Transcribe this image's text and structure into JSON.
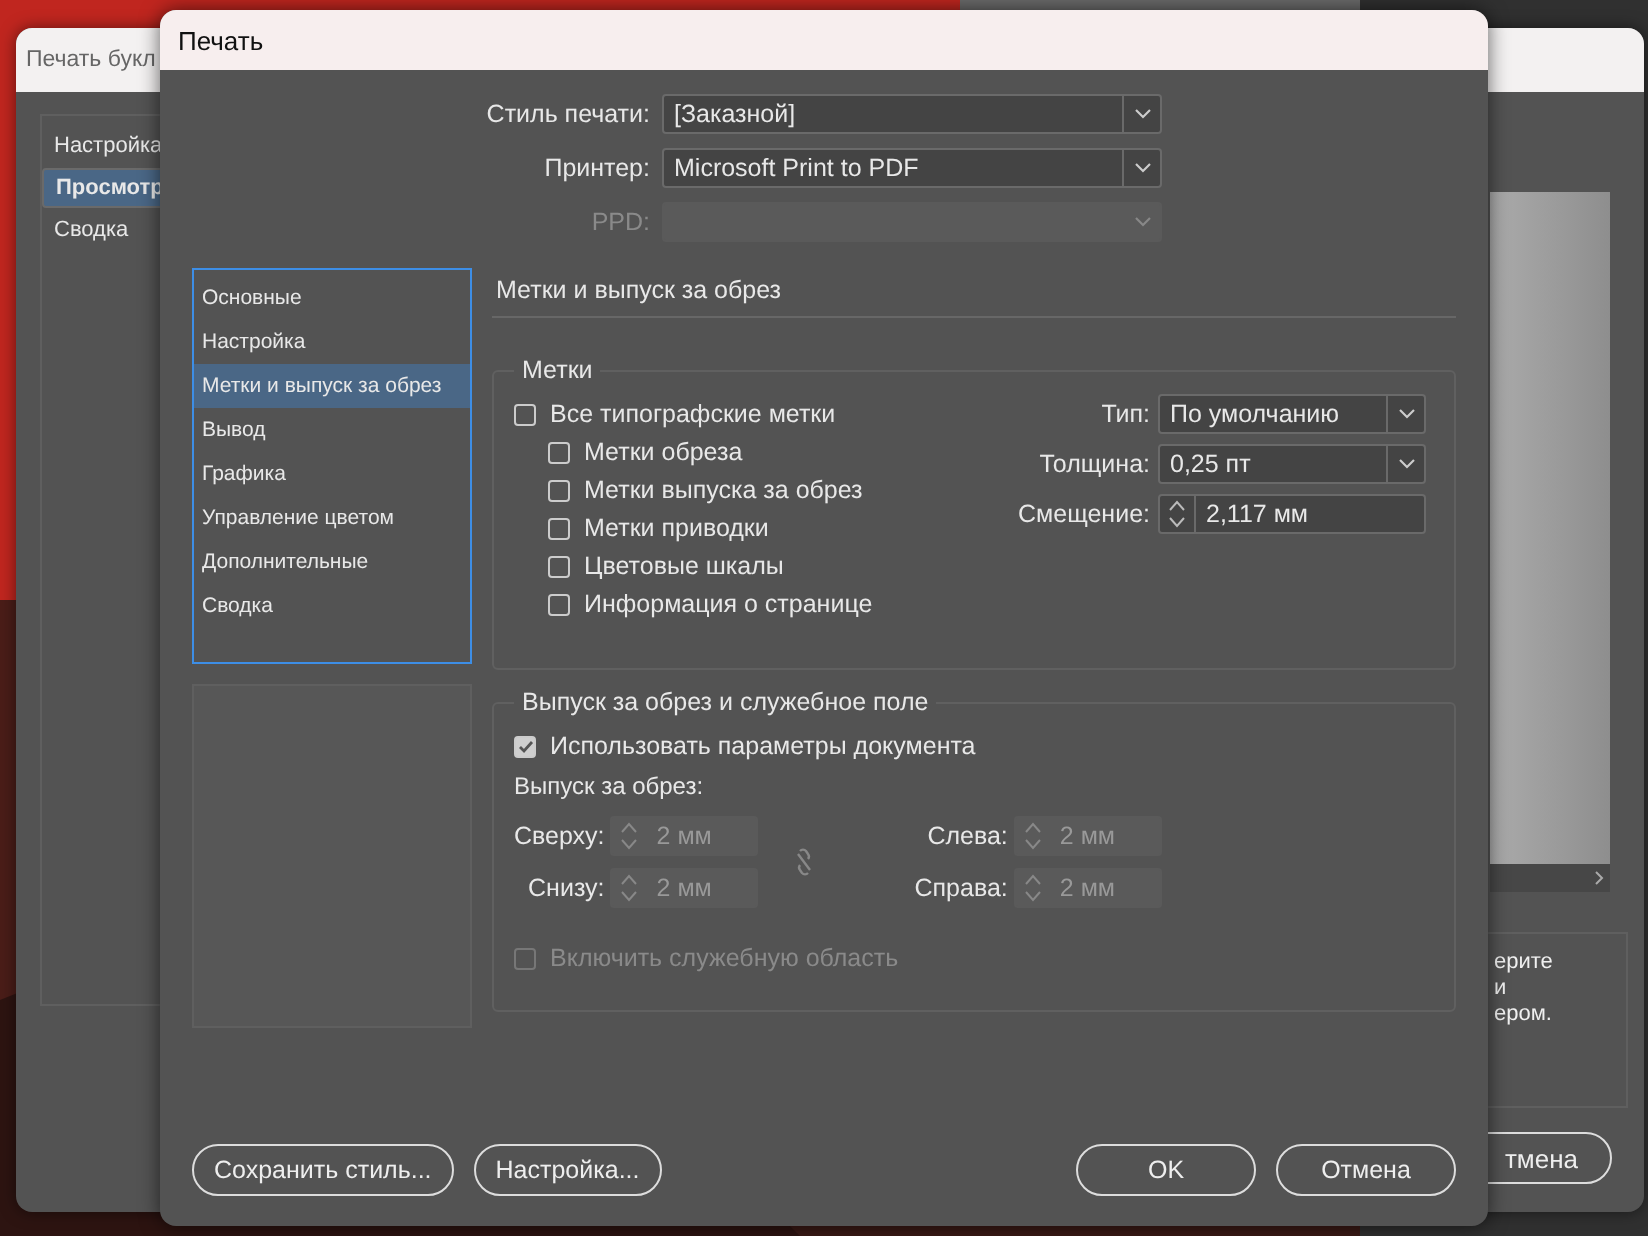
{
  "background_window": {
    "title": "Печать букл",
    "nav": [
      {
        "label": "Настройка",
        "selected": false
      },
      {
        "label": "Просмотр",
        "selected": true
      },
      {
        "label": "Сводка",
        "selected": false
      }
    ],
    "hint_lines": [
      "ерите",
      "и",
      "ером."
    ],
    "cancel_button": "тмена"
  },
  "dialog": {
    "title": "Печать",
    "fields": [
      {
        "label": "Стиль печати:",
        "value": "[Заказной]",
        "disabled": false
      },
      {
        "label": "Принтер:",
        "value": "Microsoft Print to PDF",
        "disabled": false
      },
      {
        "label": "PPD:",
        "disabled": true
      }
    ],
    "categories": [
      {
        "label": "Основные",
        "selected": false
      },
      {
        "label": "Настройка",
        "selected": false
      },
      {
        "label": "Метки и выпуск за обрез",
        "selected": true
      },
      {
        "label": "Вывод",
        "selected": false
      },
      {
        "label": "Графика",
        "selected": false
      },
      {
        "label": "Управление цветом",
        "selected": false
      },
      {
        "label": "Дополнительные",
        "selected": false
      },
      {
        "label": "Сводка",
        "selected": false
      }
    ],
    "section_title": "Метки и выпуск за обрез",
    "marks": {
      "title": "Метки",
      "checkboxes": [
        {
          "label": "Все типографские метки",
          "checked": false,
          "children": [
            {
              "label": "Метки обреза",
              "checked": false
            },
            {
              "label": "Метки выпуска за обрез",
              "checked": false
            },
            {
              "label": "Метки приводки",
              "checked": false
            },
            {
              "label": "Цветовые шкалы",
              "checked": false
            },
            {
              "label": "Информация о странице",
              "checked": false
            }
          ]
        }
      ],
      "settings": [
        {
          "kind": "select",
          "label": "Тип:",
          "value": "По умолчанию"
        },
        {
          "kind": "select",
          "label": "Толщина:",
          "value": "0,25 пт"
        },
        {
          "kind": "spinner",
          "label": "Смещение:",
          "value": "2,117 мм"
        }
      ]
    },
    "bleed": {
      "title": "Выпуск за обрез и служебное поле",
      "use_document": {
        "label": "Использовать параметры документа",
        "checked": true
      },
      "subtitle": "Выпуск за обрез:",
      "fields": [
        {
          "label": "Сверху:",
          "value": "2 мм",
          "disabled": true
        },
        {
          "label": "Снизу:",
          "value": "2 мм",
          "disabled": true
        },
        {
          "label": "Слева:",
          "value": "2 мм",
          "disabled": true
        },
        {
          "label": "Справа:",
          "value": "2 мм",
          "disabled": true
        }
      ],
      "slug": {
        "label": "Включить служебную область",
        "checked": false,
        "disabled": true
      }
    },
    "left_buttons": [
      "Сохранить стиль...",
      "Настройка..."
    ],
    "right_buttons": [
      "OK",
      "Отмена"
    ]
  }
}
